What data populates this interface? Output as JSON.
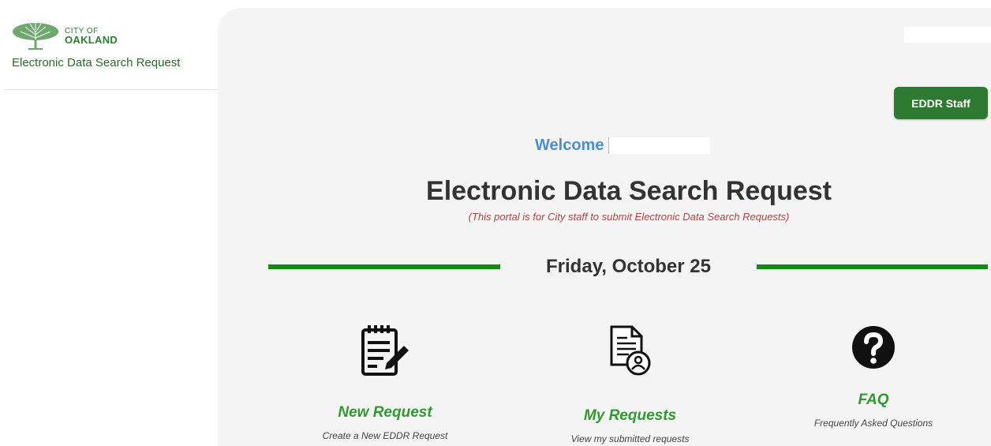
{
  "sidebar": {
    "logo_line1": "CITY OF",
    "logo_line2": "OAKLAND",
    "app_title": "Electronic Data Search Request"
  },
  "header": {
    "staff_button_label": "EDDR Staff",
    "welcome_label": "Welcome"
  },
  "main": {
    "title": "Electronic Data Search Request",
    "subtitle": "(This portal is for City staff to submit Electronic Data Search Requests)",
    "date": "Friday, October 25"
  },
  "cards": [
    {
      "title": "New Request",
      "description": "Create a New EDDR Request",
      "icon": "clipboard-edit-icon"
    },
    {
      "title": "My Requests",
      "description": "View my submitted requests",
      "icon": "document-user-icon"
    },
    {
      "title": "FAQ",
      "description": "Frequently Asked Questions",
      "icon": "question-circle-icon"
    }
  ],
  "colors": {
    "accent_green": "#2e7a33",
    "welcome_blue": "#4a8fd0",
    "subtitle_red": "#b04545"
  }
}
